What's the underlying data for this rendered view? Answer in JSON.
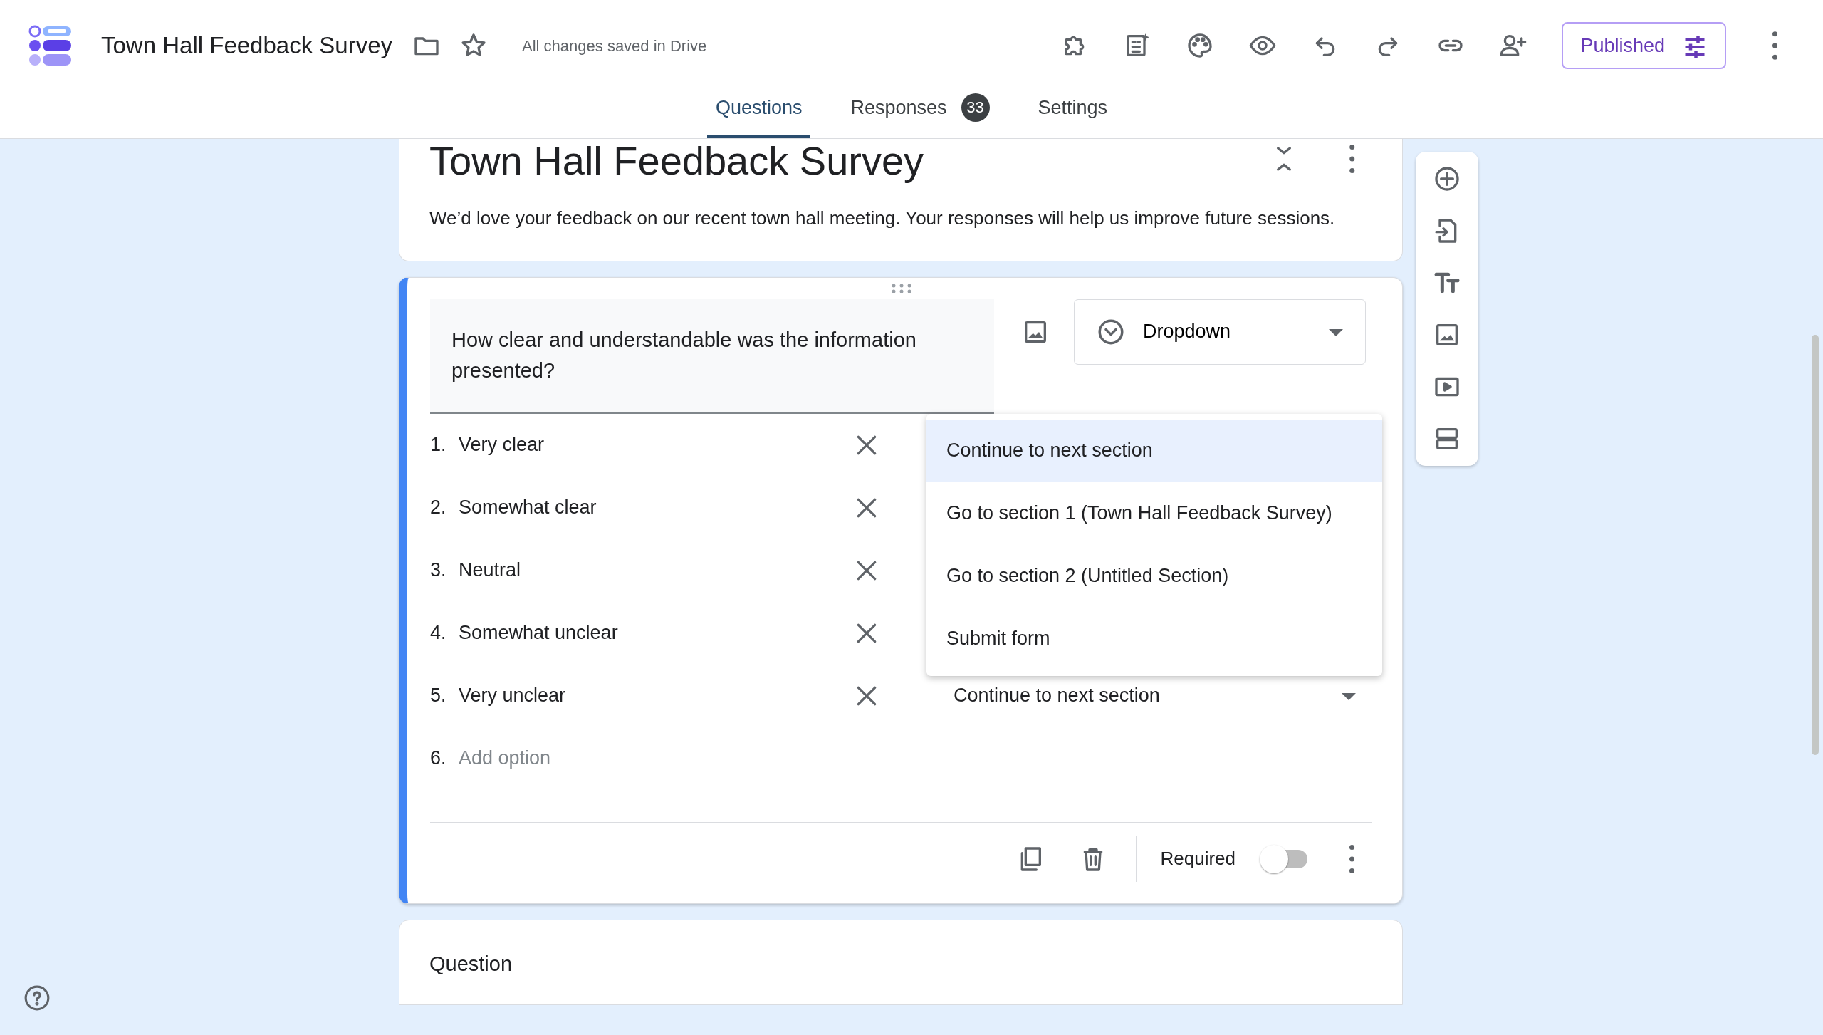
{
  "app": {
    "title": "Town Hall Feedback Survey",
    "save_status": "All changes saved in Drive",
    "publish_button": "Published"
  },
  "tabs": [
    {
      "label": "Questions",
      "selected": true
    },
    {
      "label": "Responses",
      "selected": false,
      "badge": "33"
    },
    {
      "label": "Settings",
      "selected": false
    }
  ],
  "form_header": {
    "title": "Town Hall Feedback Survey",
    "description": "We’d love your feedback on our recent town hall meeting. Your responses will help us improve future sessions."
  },
  "question": {
    "text": "How clear and understandable was the information presented?",
    "type": "Dropdown",
    "options": [
      {
        "number": "1.",
        "label": "Very clear"
      },
      {
        "number": "2.",
        "label": "Somewhat clear"
      },
      {
        "number": "3.",
        "label": "Neutral"
      },
      {
        "number": "4.",
        "label": "Somewhat unclear"
      },
      {
        "number": "5.",
        "label": "Very unclear",
        "goto": "Continue to next section"
      }
    ],
    "add_option": {
      "number": "6.",
      "placeholder": "Add option"
    },
    "goto_menu": [
      {
        "label": "Continue to next section",
        "selected": true
      },
      {
        "label": "Go to section 1 (Town Hall Feedback Survey)",
        "selected": false
      },
      {
        "label": "Go to section 2 (Untitled Section)",
        "selected": false
      },
      {
        "label": "Submit form",
        "selected": false
      }
    ],
    "required_label": "Required",
    "required": false
  },
  "next_question": {
    "title": "Question"
  }
}
